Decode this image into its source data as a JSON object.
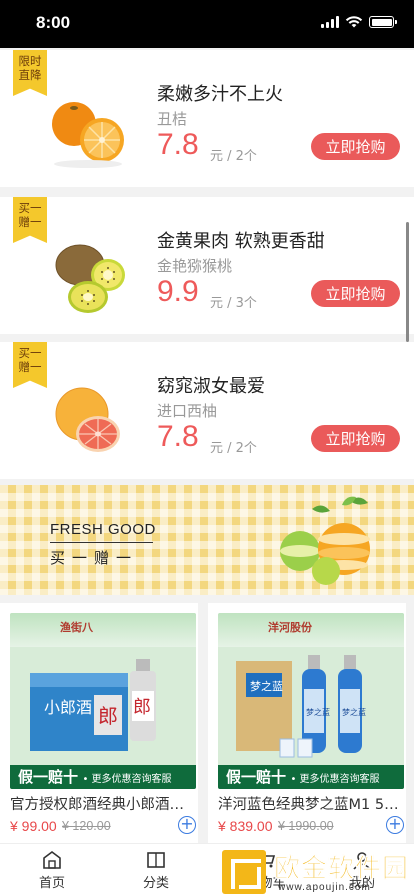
{
  "status_bar": {
    "time": "8:00"
  },
  "deals": [
    {
      "ribbon": "限时直降",
      "title": "柔嫩多汁不上火",
      "subtitle": "丑桔",
      "price": "7.8",
      "unit": "元 / 2个",
      "button": "立即抢购",
      "fruit": "orange"
    },
    {
      "ribbon": "买一赠一",
      "title": "金黄果肉 软熟更香甜",
      "subtitle": "金艳猕猴桃",
      "price": "9.9",
      "unit": "元 / 3个",
      "button": "立即抢购",
      "fruit": "kiwi"
    },
    {
      "ribbon": "买一赠一",
      "title": "窈窕淑女最爱",
      "subtitle": "进口西柚",
      "price": "7.8",
      "unit": "元 / 2个",
      "button": "立即抢购",
      "fruit": "grapefruit"
    }
  ],
  "banner": {
    "title": "FRESH GOOD",
    "subtitle": "买一赠一"
  },
  "products": [
    {
      "name": "官方授权郎酒经典小郎酒…",
      "price": "¥ 99.00",
      "original_price": "¥ 120.00",
      "badge_main": "假一赔十",
      "badge_note": "• 更多优惠咨询客服",
      "logo": "渔街八",
      "box_label": "小郎酒",
      "box_color": "#2f84c9"
    },
    {
      "name": "洋河蓝色经典梦之蓝M1 5…",
      "price": "¥ 839.00",
      "original_price": "¥ 1990.00",
      "badge_main": "假一赔十",
      "badge_note": "• 更多优惠咨询客服",
      "logo": "洋河股份",
      "box_label": "梦之蓝",
      "box_color": "#1f6fbf"
    }
  ],
  "tabs": [
    {
      "label": "首页",
      "icon": "home-icon"
    },
    {
      "label": "分类",
      "icon": "category-icon"
    },
    {
      "label": "购物车",
      "icon": "cart-icon"
    },
    {
      "label": "我的",
      "icon": "profile-icon"
    }
  ],
  "watermark": {
    "text": "欧金软件园",
    "url": "www.apoujin.com"
  },
  "colors": {
    "accent": "#ea5a5a",
    "ribbon": "#f4c82c",
    "badge_bar": "#0f6b3c",
    "watermark": "#f3b718"
  }
}
